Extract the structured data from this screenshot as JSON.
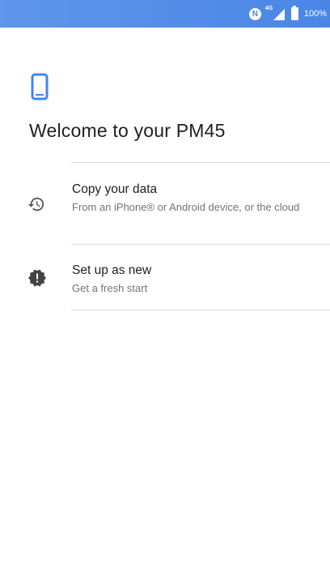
{
  "status_bar": {
    "network_label": "4G",
    "battery_label": "100%",
    "nfc_icon": "nfc-icon",
    "signal_icon": "signal-icon",
    "battery_icon": "battery-icon"
  },
  "main": {
    "header_icon": "phone-icon",
    "title": "Welcome to your PM45",
    "options": [
      {
        "icon": "history-icon",
        "title": "Copy your data",
        "subtitle": "From an iPhone® or Android device, or the cloud"
      },
      {
        "icon": "alert-badge-icon",
        "title": "Set up as new",
        "subtitle": "Get a fresh start"
      }
    ]
  },
  "colors": {
    "status_bar": "#4a86e6",
    "accent": "#4285f4",
    "title_text": "#212121",
    "secondary_text": "#737373",
    "divider": "#dcdcdc"
  }
}
